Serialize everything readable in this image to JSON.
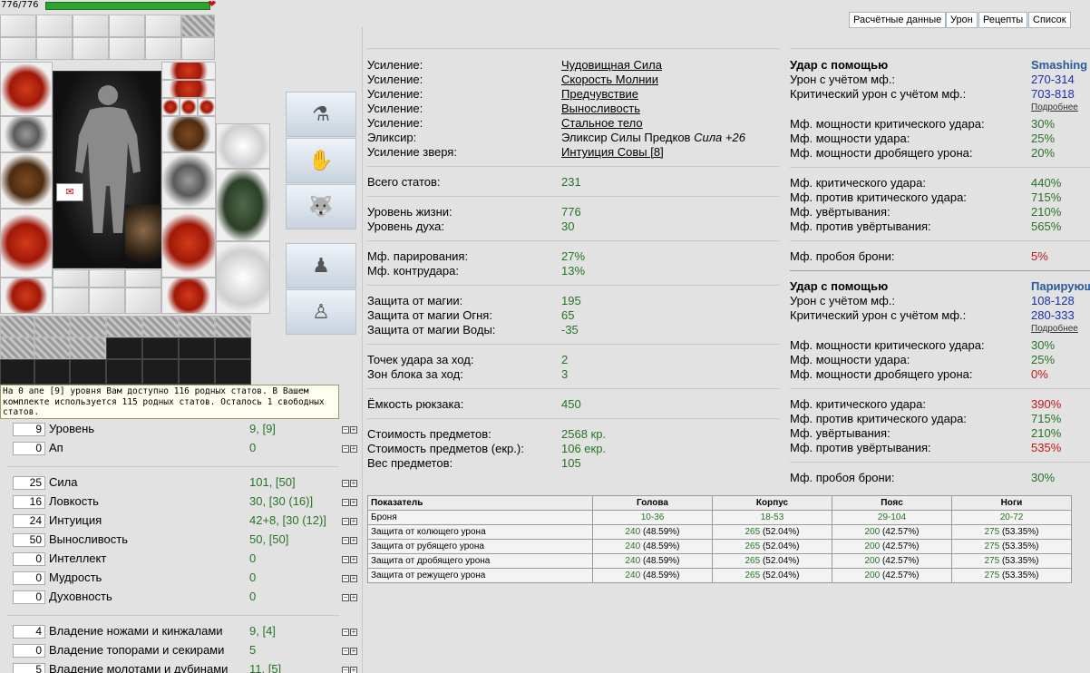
{
  "hp": {
    "text": "776/776",
    "fraction": 1.0
  },
  "tooltip": "На 0 апе [9] уровня Вам доступно 116 родных статов. В Вашем комплекте используется 115 родных статов. Осталось 1 свободных статов.",
  "stats": [
    {
      "value": "9",
      "name": "Уровень",
      "info": "9, [9]"
    },
    {
      "value": "0",
      "name": "Ап",
      "info": "0"
    },
    {
      "value": "25",
      "name": "Сила",
      "info": "101, [50]"
    },
    {
      "value": "16",
      "name": "Ловкость",
      "info": "30, [30 (16)]"
    },
    {
      "value": "24",
      "name": "Интуиция",
      "info": "42+8, [30 (12)]"
    },
    {
      "value": "50",
      "name": "Выносливость",
      "info": "50, [50]"
    },
    {
      "value": "0",
      "name": "Интеллект",
      "info": "0"
    },
    {
      "value": "0",
      "name": "Мудрость",
      "info": "0"
    },
    {
      "value": "0",
      "name": "Духовность",
      "info": "0"
    },
    {
      "value": "4",
      "name": "Владение ножами и кинжалами",
      "info": "9, [4]"
    },
    {
      "value": "0",
      "name": "Владение топорами и секирами",
      "info": "5"
    },
    {
      "value": "5",
      "name": "Владение молотами и дубинами",
      "info": "11, [5]"
    }
  ],
  "tabs": [
    "Расчётные данные",
    "Урон",
    "Рецепты",
    "Список"
  ],
  "effects": [
    {
      "label": "Усиление:",
      "value": "Чудовищная Сила"
    },
    {
      "label": "Усиление:",
      "value": "Скорость Молнии"
    },
    {
      "label": "Усиление:",
      "value": "Предчувствие"
    },
    {
      "label": "Усиление:",
      "value": "Выносливость"
    },
    {
      "label": "Усиление:",
      "value": "Стальное тело"
    },
    {
      "label": "Эликсир:",
      "value": "Эликсир Силы Предков",
      "extra": "Сила +26"
    },
    {
      "label": "Усиление зверя:",
      "value": "Интуиция Совы [8]"
    }
  ],
  "summary": [
    {
      "label": "Всего статов:",
      "value": "231"
    },
    {
      "label": "Уровень жизни:",
      "value": "776"
    },
    {
      "label": "Уровень духа:",
      "value": "30"
    },
    {
      "label": "Мф. парирования:",
      "value": "27%"
    },
    {
      "label": "Мф. контрудара:",
      "value": "13%"
    },
    {
      "label": "Защита от магии:",
      "value": "195"
    },
    {
      "label": "Защита от магии Огня:",
      "value": "65"
    },
    {
      "label": "Защита от магии Воды:",
      "value": "-35"
    },
    {
      "label": "Точек удара за ход:",
      "value": "2"
    },
    {
      "label": "Зон блока за ход:",
      "value": "3"
    },
    {
      "label": "Ёмкость рюкзака:",
      "value": "450"
    },
    {
      "label": "Стоимость предметов:",
      "value": "2568 кр."
    },
    {
      "label": "Стоимость предметов (екр.):",
      "value": "106 екр."
    },
    {
      "label": "Вес предметов:",
      "value": "105"
    }
  ],
  "attack1": {
    "header": "Удар с помощью",
    "weapon": "Smashing",
    "damage_label": "Урон с учётом мф.:",
    "damage": "270-314",
    "crit_label": "Критический урон с учётом мф.:",
    "crit": "703-818",
    "more": "Подробнее",
    "rows": [
      {
        "label": "Мф. мощности критического удара:",
        "value": "30%",
        "color": "g"
      },
      {
        "label": "Мф. мощности удара:",
        "value": "25%",
        "color": "g"
      },
      {
        "label": "Мф. мощности дробящего урона:",
        "value": "20%",
        "color": "g"
      },
      {
        "label": "Мф. критического удара:",
        "value": "440%",
        "color": "g"
      },
      {
        "label": "Мф. против критического удара:",
        "value": "715%",
        "color": "g"
      },
      {
        "label": "Мф. увёртывания:",
        "value": "210%",
        "color": "g"
      },
      {
        "label": "Мф. против увёртывания:",
        "value": "565%",
        "color": "g"
      },
      {
        "label": "Мф. пробоя брони:",
        "value": "5%",
        "color": "r"
      }
    ]
  },
  "attack2": {
    "header": "Удар с помощью",
    "weapon": "Парирующ",
    "damage_label": "Урон с учётом мф.:",
    "damage": "108-128",
    "crit_label": "Критический урон с учётом мф.:",
    "crit": "280-333",
    "more": "Подробнее",
    "rows": [
      {
        "label": "Мф. мощности критического удара:",
        "value": "30%",
        "color": "g"
      },
      {
        "label": "Мф. мощности удара:",
        "value": "25%",
        "color": "g"
      },
      {
        "label": "Мф. мощности дробящего урона:",
        "value": "0%",
        "color": "r"
      },
      {
        "label": "Мф. критического удара:",
        "value": "390%",
        "color": "r"
      },
      {
        "label": "Мф. против критического удара:",
        "value": "715%",
        "color": "g"
      },
      {
        "label": "Мф. увёртывания:",
        "value": "210%",
        "color": "g"
      },
      {
        "label": "Мф. против увёртывания:",
        "value": "535%",
        "color": "r"
      },
      {
        "label": "Мф. пробоя брони:",
        "value": "30%",
        "color": "g"
      }
    ]
  },
  "armor_table": {
    "headers": [
      "Показатель",
      "Голова",
      "Корпус",
      "Пояс",
      "Ноги"
    ],
    "rows": [
      {
        "name": "Броня",
        "cells": [
          "10-36",
          "18-53",
          "29-104",
          "20-72"
        ]
      },
      {
        "name": "Защита от колющего урона",
        "cells": [
          [
            "240",
            "(48.59%)"
          ],
          [
            "265",
            "(52.04%)"
          ],
          [
            "200",
            "(42.57%)"
          ],
          [
            "275",
            "(53.35%)"
          ]
        ]
      },
      {
        "name": "Защита от рубящего урона",
        "cells": [
          [
            "240",
            "(48.59%)"
          ],
          [
            "265",
            "(52.04%)"
          ],
          [
            "200",
            "(42.57%)"
          ],
          [
            "275",
            "(53.35%)"
          ]
        ]
      },
      {
        "name": "Защита от дробящего урона",
        "cells": [
          [
            "240",
            "(48.59%)"
          ],
          [
            "265",
            "(52.04%)"
          ],
          [
            "200",
            "(42.57%)"
          ],
          [
            "275",
            "(53.35%)"
          ]
        ]
      },
      {
        "name": "Защита от режущего урона",
        "cells": [
          [
            "240",
            "(48.59%)"
          ],
          [
            "265",
            "(52.04%)"
          ],
          [
            "200",
            "(42.57%)"
          ],
          [
            "275",
            "(53.35%)"
          ]
        ]
      }
    ]
  },
  "colors": {
    "green": "#267326",
    "blue": "#1a2faa",
    "red": "#c01818",
    "hp": "#2fa22f"
  }
}
